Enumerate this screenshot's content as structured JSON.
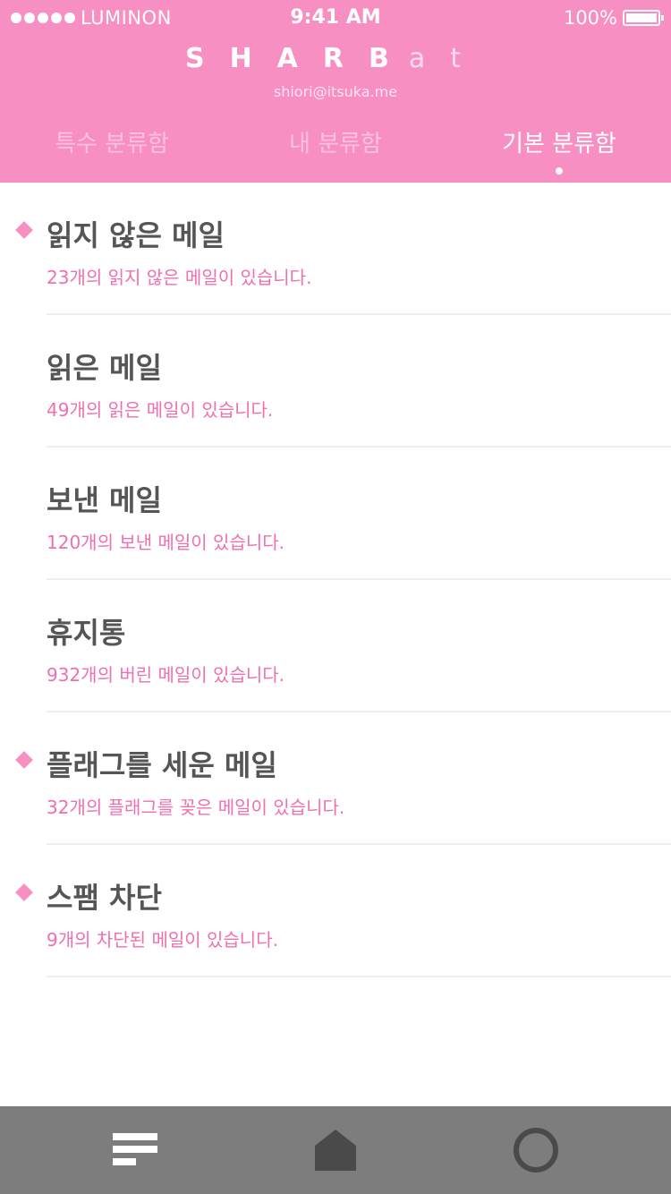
{
  "status_bar": {
    "carrier": "LUMINON",
    "time": "9:41 AM",
    "battery": "100%"
  },
  "header": {
    "brand_main": "SHARB",
    "brand_sub": "at",
    "email": "shiori@itsuka.me"
  },
  "tabs": [
    {
      "label": "특수 분류함",
      "active": false
    },
    {
      "label": "내 분류함",
      "active": false
    },
    {
      "label": "기본 분류함",
      "active": true
    }
  ],
  "mailboxes": [
    {
      "title": "읽지 않은 메일",
      "description": "23개의 읽지 않은 메일이 있습니다.",
      "marked": true
    },
    {
      "title": "읽은 메일",
      "description": "49개의 읽은 메일이 있습니다.",
      "marked": false
    },
    {
      "title": "보낸 메일",
      "description": "120개의 보낸 메일이 있습니다.",
      "marked": false
    },
    {
      "title": "휴지통",
      "description": "932개의 버린 메일이 있습니다.",
      "marked": false
    },
    {
      "title": "플래그를 세운 메일",
      "description": "32개의 플래그를 꽂은 메일이 있습니다.",
      "marked": true
    },
    {
      "title": "스팸 차단",
      "description": "9개의 차단된 메일이 있습니다.",
      "marked": true
    }
  ],
  "bottom_nav": [
    {
      "icon": "menu-icon"
    },
    {
      "icon": "home-icon"
    },
    {
      "icon": "circle-icon"
    }
  ],
  "colors": {
    "accent": "#f88fc3",
    "accent_text": "#f06faf",
    "title_text": "#555555",
    "bottom_bar": "#7d7d7d"
  }
}
